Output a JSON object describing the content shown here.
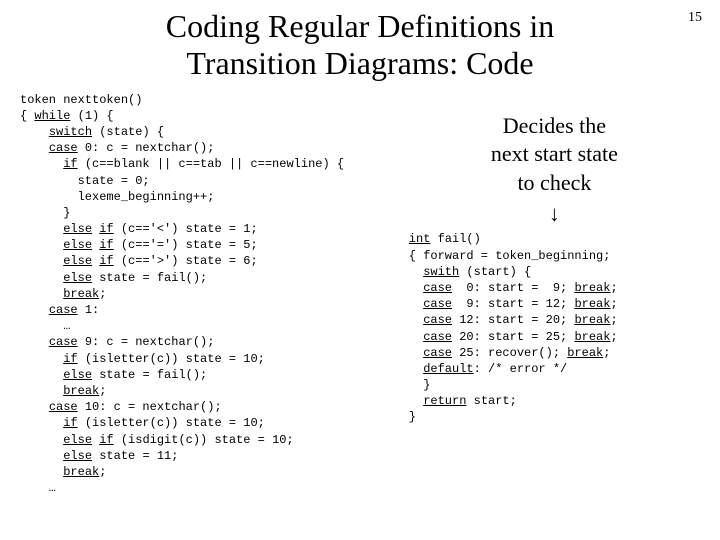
{
  "page_number": "15",
  "title_l1": "Coding Regular Definitions in",
  "title_l2": "Transition Diagrams: Code",
  "note_l1": "Decides the",
  "note_l2": "next start state",
  "note_l3": "to check",
  "arrow": "↓",
  "code_left": {
    "l01_a": "token nexttoken()",
    "l02_a": "{ ",
    "l02_u": "while",
    "l02_b": " (1) {",
    "l03_a": "    ",
    "l03_u": "switch",
    "l03_b": " (state) {",
    "l04_a": "    ",
    "l04_u": "case",
    "l04_b": " 0: c = nextchar();",
    "l05_a": "      ",
    "l05_u": "if",
    "l05_b": " (c==blank || c==tab || c==newline) {",
    "l06_a": "        state = 0;",
    "l07_a": "        lexeme_beginning++;",
    "l08_a": "      }",
    "l09_a": "      ",
    "l09_u1": "else",
    "l09_b": " ",
    "l09_u2": "if",
    "l09_c": " (c=='<') state = 1;",
    "l10_a": "      ",
    "l10_u1": "else",
    "l10_b": " ",
    "l10_u2": "if",
    "l10_c": " (c=='=') state = 5;",
    "l11_a": "      ",
    "l11_u1": "else",
    "l11_b": " ",
    "l11_u2": "if",
    "l11_c": " (c=='>') state = 6;",
    "l12_a": "      ",
    "l12_u": "else",
    "l12_b": " state = fail();",
    "l13_a": "      ",
    "l13_u": "break",
    "l13_b": ";",
    "l14_a": "    ",
    "l14_u": "case",
    "l14_b": " 1:",
    "l15_a": "      …",
    "l16_a": "    ",
    "l16_u": "case",
    "l16_b": " 9: c = nextchar();",
    "l17_a": "      ",
    "l17_u": "if",
    "l17_b": " (isletter(c)) state = 10;",
    "l18_a": "      ",
    "l18_u": "else",
    "l18_b": " state = fail();",
    "l19_a": "      ",
    "l19_u": "break",
    "l19_b": ";",
    "l20_a": "    ",
    "l20_u": "case",
    "l20_b": " 10: c = nextchar();",
    "l21_a": "      ",
    "l21_u": "if",
    "l21_b": " (isletter(c)) state = 10;",
    "l22_a": "      ",
    "l22_u1": "else",
    "l22_b": " ",
    "l22_u2": "if",
    "l22_c": " (isdigit(c)) state = 10;",
    "l23_a": "      ",
    "l23_u": "else",
    "l23_b": " state = 11;",
    "l24_a": "      ",
    "l24_u": "break",
    "l24_b": ";",
    "l25_a": "    …"
  },
  "code_right": {
    "r01_u": "int",
    "r01_b": " fail()",
    "r02_a": "{ forward = token_beginning;",
    "r03_a": "  ",
    "r03_u": "swith",
    "r03_b": " (start) {",
    "r04_a": "  ",
    "r04_u1": "case",
    "r04_b": "  0: start =  9; ",
    "r04_u2": "break",
    "r04_c": ";",
    "r05_a": "  ",
    "r05_u1": "case",
    "r05_b": "  9: start = 12; ",
    "r05_u2": "break",
    "r05_c": ";",
    "r06_a": "  ",
    "r06_u1": "case",
    "r06_b": " 12: start = 20; ",
    "r06_u2": "break",
    "r06_c": ";",
    "r07_a": "  ",
    "r07_u1": "case",
    "r07_b": " 20: start = 25; ",
    "r07_u2": "break",
    "r07_c": ";",
    "r08_a": "  ",
    "r08_u1": "case",
    "r08_b": " 25: recover(); ",
    "r08_u2": "break",
    "r08_c": ";",
    "r09_a": "  ",
    "r09_u": "default",
    "r09_b": ": /* error */",
    "r10_a": "  }",
    "r11_a": "  ",
    "r11_u": "return",
    "r11_b": " start;",
    "r12_a": "}"
  }
}
